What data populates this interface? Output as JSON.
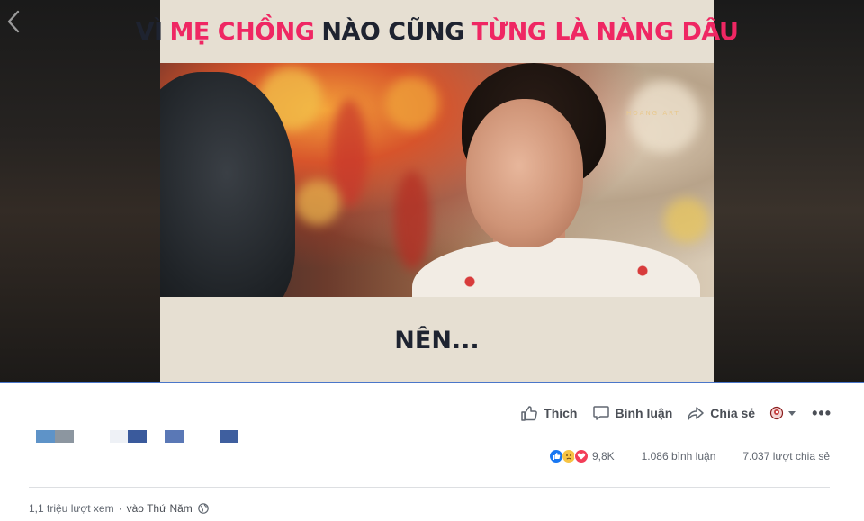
{
  "video": {
    "caption_top": {
      "part1": "VÌ",
      "part2": "MẸ CHỒNG",
      "part3": "NÀO CŨNG",
      "part4": "TỪNG LÀ NÀNG DÂU"
    },
    "watermark": "HOANG ART",
    "caption_bottom": "NÊN...",
    "highlight_color": "#ef2763",
    "caption_bg": "#e6dfd2"
  },
  "actions": {
    "like_label": "Thích",
    "comment_label": "Bình luận",
    "share_label": "Chia sẻ",
    "audience_icon": "public-globe-icon",
    "more_icon": "more-dots-icon"
  },
  "stats": {
    "reactions": [
      "like",
      "sad",
      "love"
    ],
    "reaction_count": "9,8K",
    "comments": "1.086 bình luận",
    "shares": "7.037 lượt chia sẻ"
  },
  "meta": {
    "views": "1,1 triệu lượt xem",
    "separator": "·",
    "posted": "vào Thứ Năm",
    "privacy_icon": "globe-icon"
  },
  "colors": {
    "fb_blue": "#4267b2",
    "text_gray": "#616770",
    "action_gray": "#4b4f56"
  }
}
